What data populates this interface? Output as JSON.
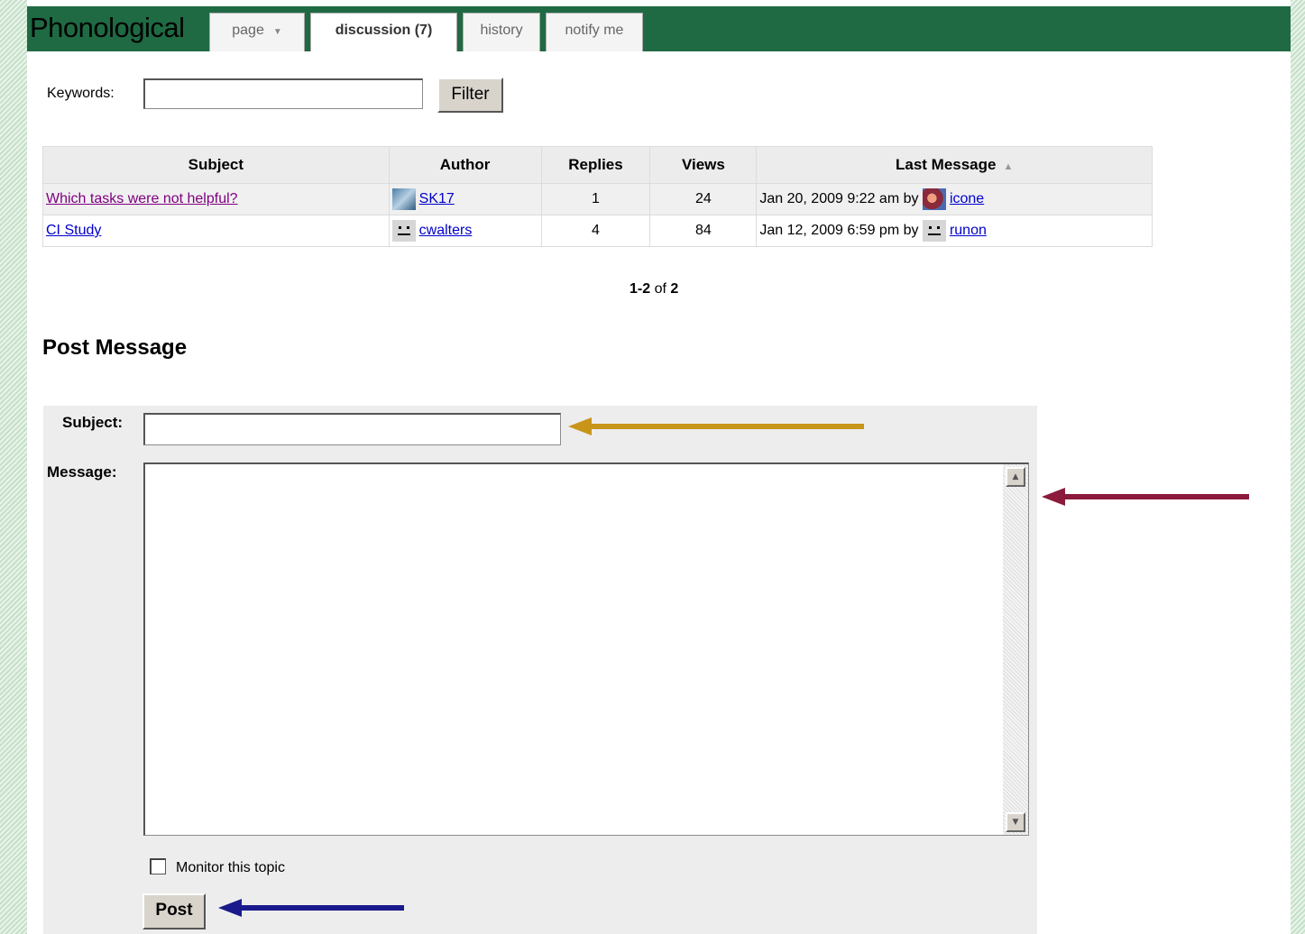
{
  "header": {
    "title": "Phonological",
    "tabs": [
      {
        "label": "page",
        "has_caret": true
      },
      {
        "label": "discussion (7)",
        "active": true
      },
      {
        "label": "history"
      },
      {
        "label": "notify me"
      }
    ]
  },
  "search": {
    "keywords_label": "Keywords:",
    "keywords_value": "",
    "filter_label": "Filter"
  },
  "topics_table": {
    "columns": [
      "Subject",
      "Author",
      "Replies",
      "Views",
      "Last Message"
    ],
    "rows": [
      {
        "subject": "Which tasks were not helpful?",
        "author": "SK17",
        "replies": "1",
        "views": "24",
        "last_message_date": "Jan 20, 2009 9:22 am by",
        "last_message_author": "icone"
      },
      {
        "subject": "CI Study",
        "author": "cwalters",
        "replies": "4",
        "views": "84",
        "last_message_date": "Jan 12, 2009 6:59 pm by",
        "last_message_author": "runon"
      }
    ]
  },
  "pager": {
    "range": "1-2",
    "of": "of",
    "total": "2"
  },
  "post_form": {
    "title": "Post Message",
    "subject_label": "Subject:",
    "subject_value": "",
    "message_label": "Message:",
    "message_value": "",
    "monitor_label": "Monitor this topic",
    "monitor_checked": false,
    "post_label": "Post"
  },
  "annotations": {
    "subject_arrow_color": "#c8951a",
    "message_arrow_color": "#8b1a3c",
    "post_arrow_color": "#1a1a8c"
  }
}
